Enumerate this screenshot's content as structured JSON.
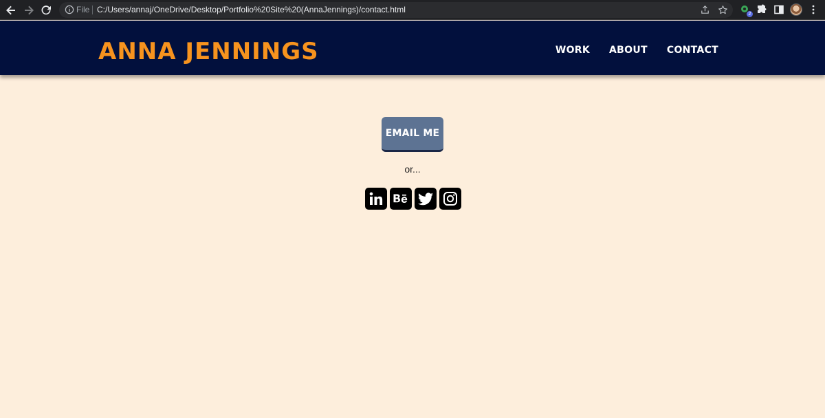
{
  "browser": {
    "file_label": "File",
    "url": "C:/Users/annaj/OneDrive/Desktop/Portfolio%20Site%20(AnnaJennings)/contact.html",
    "extension_badge": "2"
  },
  "site": {
    "title": "ANNA JENNINGS",
    "nav": [
      "WORK",
      "ABOUT",
      "CONTACT"
    ]
  },
  "content": {
    "email_button": "EMAIL ME",
    "or_text": "or...",
    "socials": [
      "linkedin-icon",
      "behance-icon",
      "twitter-icon",
      "instagram-icon"
    ]
  },
  "colors": {
    "header_bg": "#02103d",
    "title": "#f7931e",
    "page_bg": "#fdeedc",
    "button_bg": "#5d7393"
  }
}
